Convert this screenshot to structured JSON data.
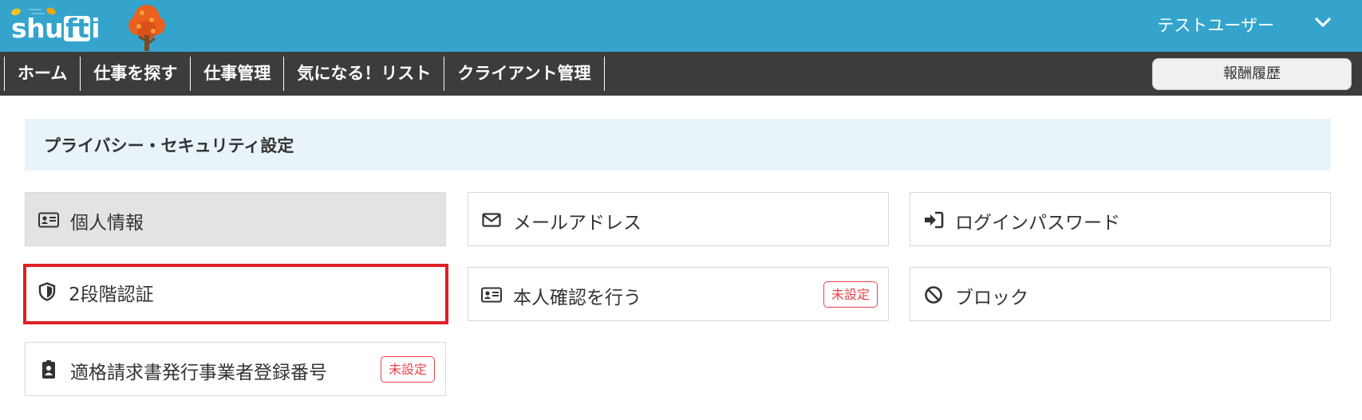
{
  "app": {
    "logo_text": "shufti",
    "user_name": "テストユーザー",
    "brand_color": "#34a4cd",
    "nav_bg_color": "#3c3c3c"
  },
  "nav": {
    "items": [
      {
        "label": "ホーム"
      },
      {
        "label": "仕事を探す"
      },
      {
        "label": "仕事管理"
      },
      {
        "label": "気になる！リスト"
      },
      {
        "label": "クライアント管理"
      }
    ],
    "reward_button": "報酬履歴"
  },
  "section": {
    "title": "プライバシー・セキュリティ設定"
  },
  "cards": [
    {
      "label": "個人情報",
      "icon": "id-card-icon",
      "state": "active"
    },
    {
      "label": "メールアドレス",
      "icon": "envelope-icon"
    },
    {
      "label": "ログインパスワード",
      "icon": "sign-in-icon"
    },
    {
      "label": "2段階認証",
      "icon": "shield-icon",
      "state": "selected"
    },
    {
      "label": "本人確認を行う",
      "icon": "id-card-icon",
      "badge": "未設定"
    },
    {
      "label": "ブロック",
      "icon": "ban-icon"
    },
    {
      "label": "適格請求書発行事業者登録番号",
      "icon": "badge-icon",
      "badge": "未設定"
    }
  ],
  "colors": {
    "selected_border": "#e01f26",
    "badge": "#e8434b",
    "section_bg": "#e8f4fa"
  }
}
